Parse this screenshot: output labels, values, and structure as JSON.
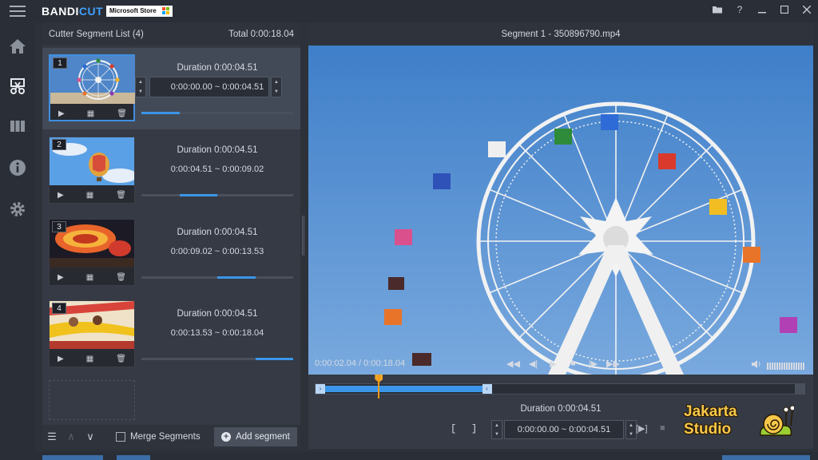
{
  "app": {
    "brand_main": "BANDI",
    "brand_accent": "CUT",
    "store_badge": "Microsoft Store"
  },
  "colors": {
    "accent": "#3b95e8",
    "playhead": "#ee9a1a",
    "background": "#2d3139"
  },
  "segment_list": {
    "title": "Cutter Segment List (4)",
    "total": "Total 0:00:18.04",
    "segments": [
      {
        "num": "1",
        "duration": "Duration 0:00:04.51",
        "range": "0:00:00.00 ~ 0:00:04.51",
        "progress_start": 0.0,
        "progress_end": 0.25,
        "active": true,
        "thumb": "ferris-wheel"
      },
      {
        "num": "2",
        "duration": "Duration 0:00:04.51",
        "range": "0:00:04.51 ~ 0:00:09.02",
        "progress_start": 0.25,
        "progress_end": 0.5,
        "active": false,
        "thumb": "hot-air-balloon"
      },
      {
        "num": "3",
        "duration": "Duration 0:00:04.51",
        "range": "0:00:09.02 ~ 0:00:13.53",
        "progress_start": 0.5,
        "progress_end": 0.75,
        "active": false,
        "thumb": "carnival-ride"
      },
      {
        "num": "4",
        "duration": "Duration 0:00:04.51",
        "range": "0:00:13.53 ~ 0:00:18.04",
        "progress_start": 0.75,
        "progress_end": 1.0,
        "active": false,
        "thumb": "roller-coaster"
      }
    ],
    "merge_label": "Merge Segments",
    "merge_checked": false,
    "add_segment_label": "Add segment"
  },
  "preview": {
    "title": "Segment 1 - 350896790.mp4",
    "time_readout": "0:00:02.04 / 0:00:18.04",
    "timeline_selection_start": 0.0,
    "timeline_selection_end": 0.25,
    "playhead_position": 0.113,
    "duration_label": "Duration 0:00:04.51",
    "range_label": "0:00:00.00 ~ 0:00:04.51",
    "bracket_start": "[",
    "bracket_end": "]"
  },
  "watermark": {
    "line1": "Jakarta",
    "line2": "Studio"
  }
}
